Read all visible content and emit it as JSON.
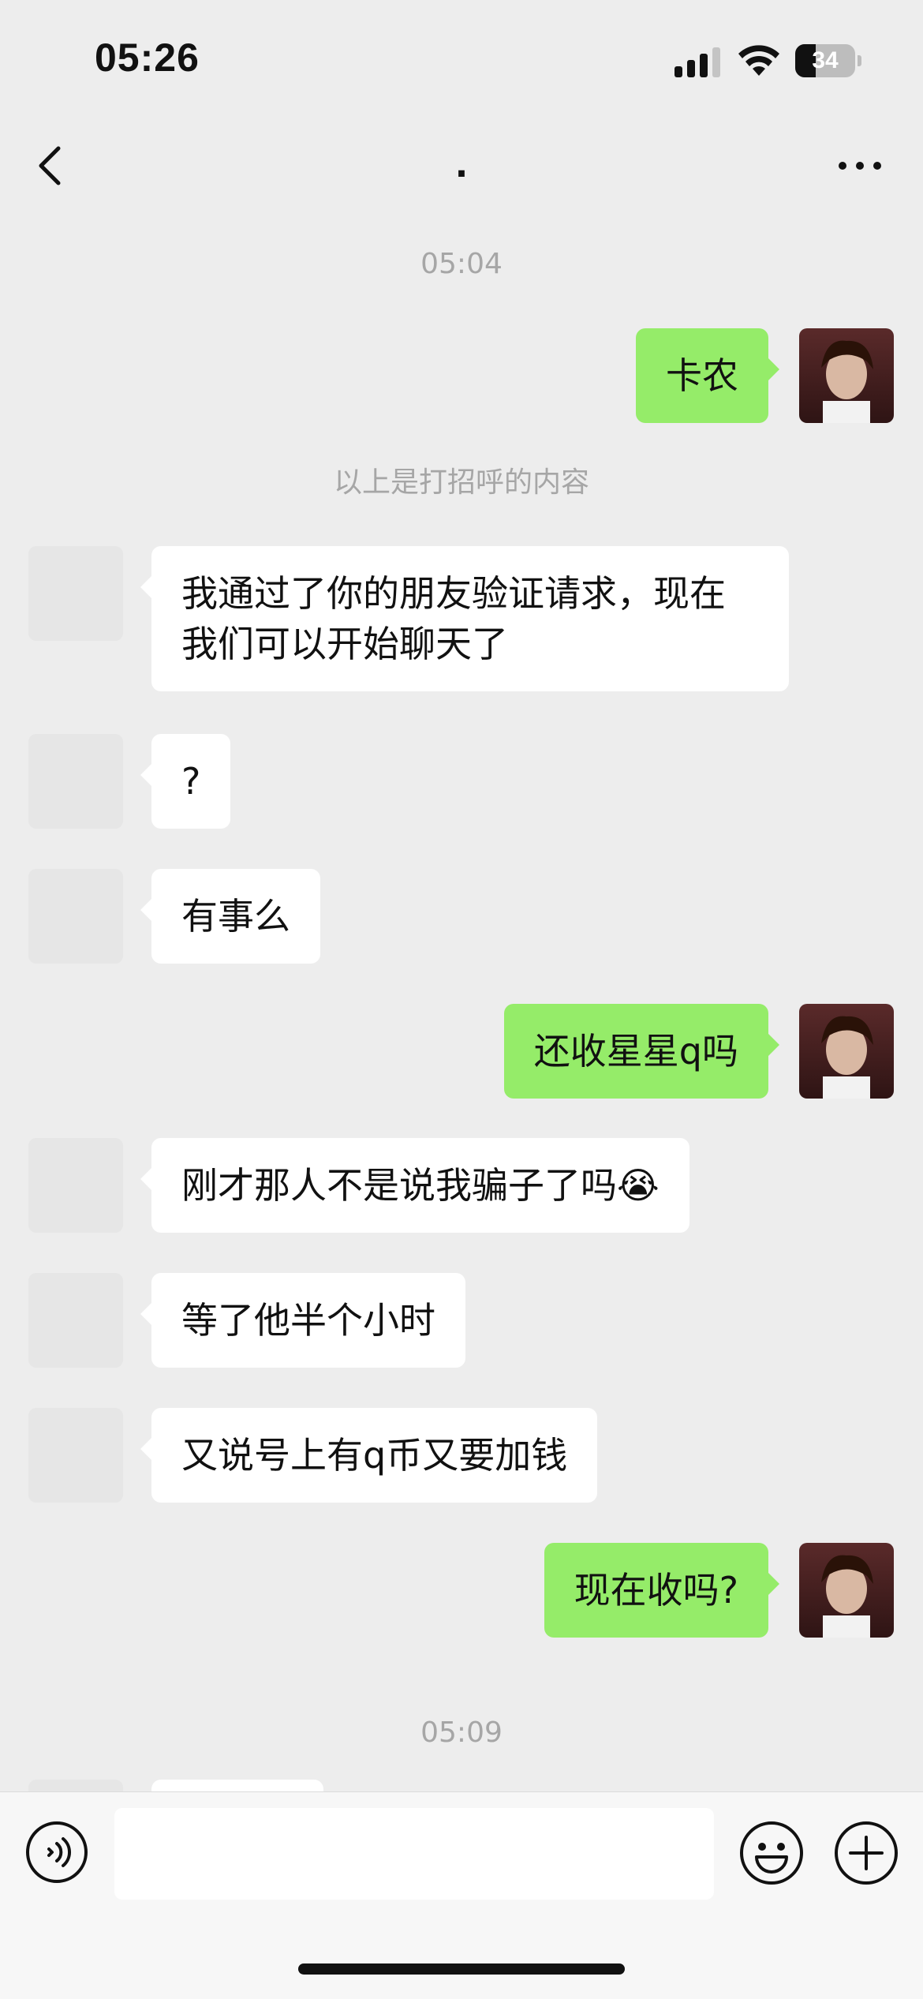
{
  "status_bar": {
    "time": "05:26",
    "battery_level": "34",
    "battery_fraction": 0.34,
    "icons": [
      "signal-icon",
      "wifi-icon",
      "battery-icon"
    ]
  },
  "nav": {
    "title": ".",
    "back_icon": "chevron-left-icon",
    "more_icon": "more-icon"
  },
  "chat": {
    "timestamp_1": "05:04",
    "timestamp_2": "05:09",
    "system_note": "以上是打招呼的内容",
    "messages": [
      {
        "side": "out",
        "text": "卡农"
      },
      {
        "side": "in",
        "lines": [
          "我通过了你的朋友验证请求，现在",
          "我们可以开始聊天了"
        ]
      },
      {
        "side": "in",
        "text": "?"
      },
      {
        "side": "in",
        "text": "有事么"
      },
      {
        "side": "out",
        "text": "还收星星q吗"
      },
      {
        "side": "in",
        "text": "刚才那人不是说我骗子了吗😭"
      },
      {
        "side": "in",
        "text": "等了他半个小时"
      },
      {
        "side": "in",
        "text": "又说号上有q币又要加钱"
      },
      {
        "side": "out",
        "text": "现在收吗?"
      }
    ]
  },
  "input_bar": {
    "placeholder": "",
    "value": "",
    "voice_icon": "voice-icon",
    "emoji_icon": "emoji-icon",
    "plus_icon": "plus-icon"
  },
  "colors": {
    "background": "#ededed",
    "outgoing_bubble": "#95ec69",
    "incoming_bubble": "#ffffff",
    "meta_text": "#a6a6a6"
  }
}
